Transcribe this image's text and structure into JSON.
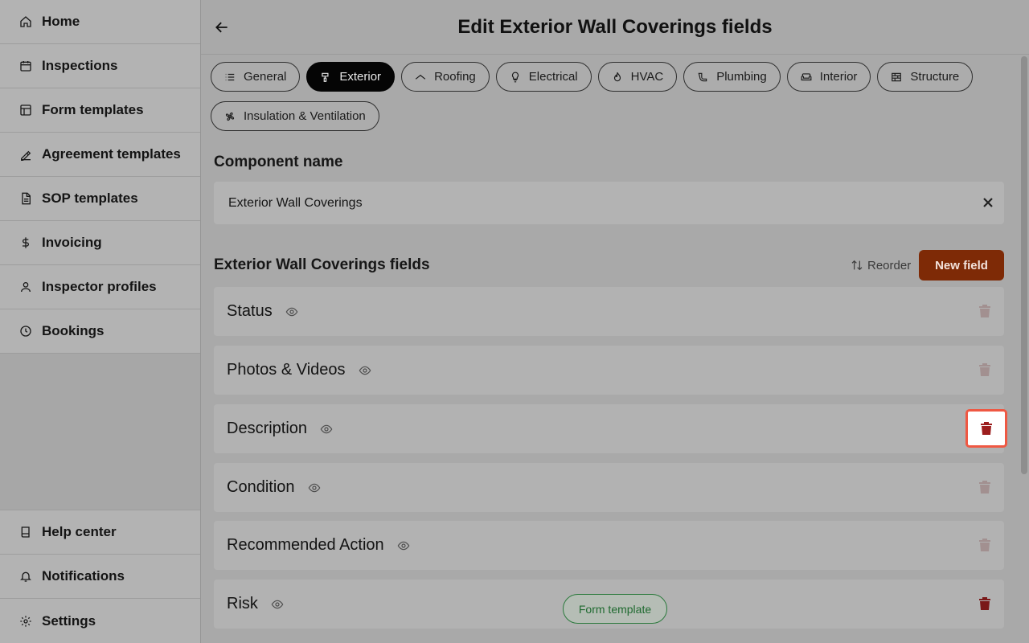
{
  "sidebar": {
    "top_items": [
      {
        "label": "Home",
        "icon": "home-icon"
      },
      {
        "label": "Inspections",
        "icon": "calendar-icon"
      },
      {
        "label": "Form templates",
        "icon": "layout-icon"
      },
      {
        "label": "Agreement templates",
        "icon": "signature-icon"
      },
      {
        "label": "SOP templates",
        "icon": "document-icon"
      },
      {
        "label": "Invoicing",
        "icon": "dollar-icon"
      },
      {
        "label": "Inspector profiles",
        "icon": "user-icon"
      },
      {
        "label": "Bookings",
        "icon": "clock-icon"
      }
    ],
    "bottom_items": [
      {
        "label": "Help center",
        "icon": "book-icon"
      },
      {
        "label": "Notifications",
        "icon": "bell-icon"
      },
      {
        "label": "Settings",
        "icon": "gear-icon"
      }
    ]
  },
  "header": {
    "title": "Edit Exterior Wall Coverings fields"
  },
  "tabs": [
    {
      "label": "General",
      "icon": "list-icon",
      "active": false
    },
    {
      "label": "Exterior",
      "icon": "paint-icon",
      "active": true
    },
    {
      "label": "Roofing",
      "icon": "roof-icon",
      "active": false
    },
    {
      "label": "Electrical",
      "icon": "lightbulb-icon",
      "active": false
    },
    {
      "label": "HVAC",
      "icon": "flame-icon",
      "active": false
    },
    {
      "label": "Plumbing",
      "icon": "pipe-icon",
      "active": false
    },
    {
      "label": "Interior",
      "icon": "sofa-icon",
      "active": false
    },
    {
      "label": "Structure",
      "icon": "brick-icon",
      "active": false
    },
    {
      "label": "Insulation & Ventilation",
      "icon": "fan-icon",
      "active": false
    }
  ],
  "component": {
    "section_label": "Component name",
    "name_value": "Exterior Wall Coverings"
  },
  "fields_section": {
    "heading": "Exterior Wall Coverings fields",
    "reorder_label": "Reorder",
    "new_field_label": "New field",
    "fields": [
      {
        "label": "Status"
      },
      {
        "label": "Photos & Videos"
      },
      {
        "label": "Description"
      },
      {
        "label": "Condition"
      },
      {
        "label": "Recommended Action"
      },
      {
        "label": "Risk"
      }
    ]
  },
  "badge": {
    "label": "Form template"
  },
  "colors": {
    "accent": "#7e2a06",
    "highlight_border": "#ef5843",
    "badge_green": "#2c7a3d"
  }
}
